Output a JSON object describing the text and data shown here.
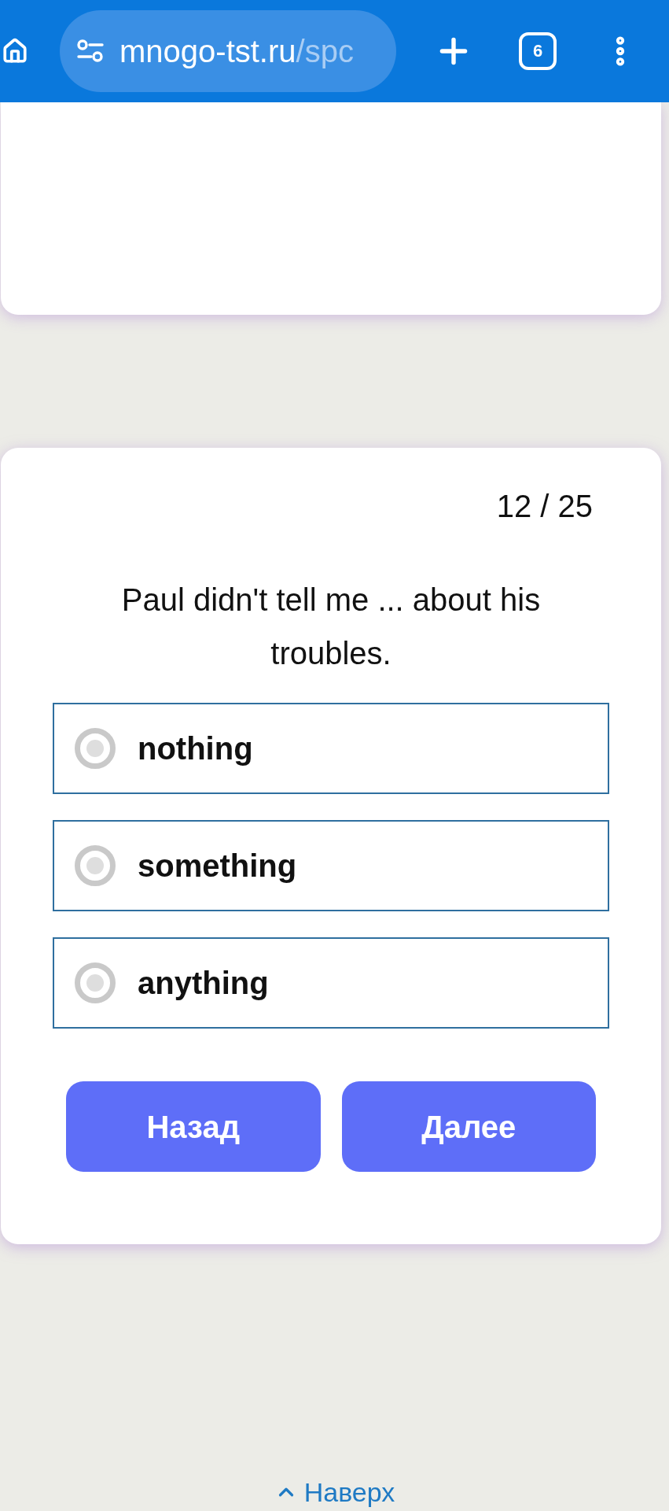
{
  "browser_bar": {
    "url_host": "mnogo-tst.ru",
    "url_path": "/spc",
    "tab_count": "6"
  },
  "quiz": {
    "progress": "12 / 25",
    "question": "Paul didn't tell me ... about his troubles.",
    "options": [
      {
        "label": "nothing",
        "selected": false
      },
      {
        "label": "something",
        "selected": false
      },
      {
        "label": "anything",
        "selected": false
      }
    ],
    "buttons": [
      "Назад",
      "Далее"
    ]
  },
  "footer": {
    "link": "Наверх"
  }
}
